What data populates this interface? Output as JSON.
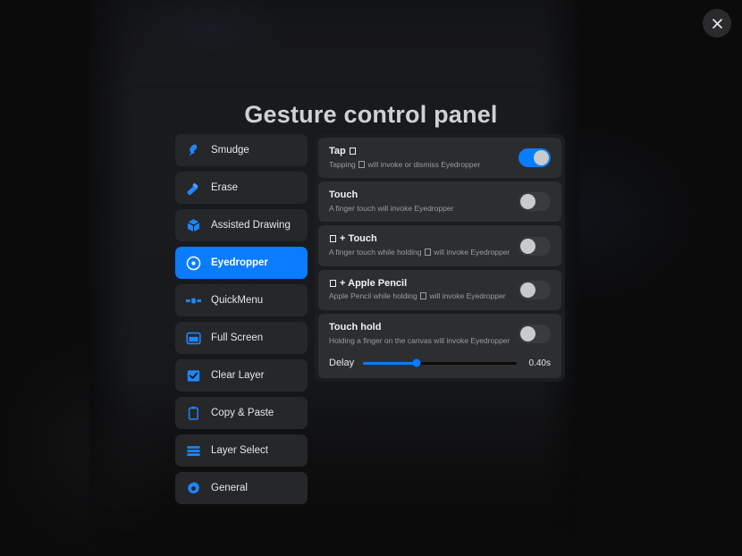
{
  "dialog": {
    "title": "Gesture control panel",
    "close_icon": "close-icon"
  },
  "accent_color": "#0a7cff",
  "sidebar": {
    "items": [
      {
        "label": "Smudge",
        "icon": "smudge-icon",
        "active": false
      },
      {
        "label": "Erase",
        "icon": "eraser-icon",
        "active": false
      },
      {
        "label": "Assisted Drawing",
        "icon": "cube-icon",
        "active": false
      },
      {
        "label": "Eyedropper",
        "icon": "eyedropper-target-icon",
        "active": true
      },
      {
        "label": "QuickMenu",
        "icon": "quickmenu-icon",
        "active": false
      },
      {
        "label": "Full Screen",
        "icon": "fullscreen-icon",
        "active": false
      },
      {
        "label": "Clear Layer",
        "icon": "checkbox-icon",
        "active": false
      },
      {
        "label": "Copy & Paste",
        "icon": "clipboard-icon",
        "active": false
      },
      {
        "label": "Layer Select",
        "icon": "layers-icon",
        "active": false
      },
      {
        "label": "General",
        "icon": "gear-icon",
        "active": false
      }
    ]
  },
  "gestures": {
    "rows": [
      {
        "title_prefix": "Tap ",
        "title_suffix": "",
        "sub_before": "Tapping ",
        "sub_after": " will invoke or dismiss Eyedropper",
        "has_tofu_title": true,
        "has_tofu_sub": true,
        "toggle_state": "on"
      },
      {
        "title_prefix": "Touch",
        "title_suffix": "",
        "sub_before": "A finger touch will invoke Eyedropper",
        "sub_after": "",
        "has_tofu_title": false,
        "has_tofu_sub": false,
        "toggle_state": "off"
      },
      {
        "title_prefix": "",
        "title_suffix": " + Touch",
        "sub_before": "A finger touch while holding ",
        "sub_after": " will invoke Eyedropper",
        "has_tofu_title": true,
        "has_tofu_sub": true,
        "toggle_state": "off"
      },
      {
        "title_prefix": "",
        "title_suffix": " + Apple Pencil",
        "sub_before": "Apple Pencil while holding ",
        "sub_after": " will invoke Eyedropper",
        "has_tofu_title": true,
        "has_tofu_sub": true,
        "toggle_state": "off"
      }
    ],
    "touch_hold": {
      "title": "Touch hold",
      "sub": "Holding a finger on the canvas will invoke Eyedropper",
      "toggle_state": "off",
      "delay_label": "Delay",
      "delay_value": "0.40s",
      "delay_percent": 35
    }
  }
}
